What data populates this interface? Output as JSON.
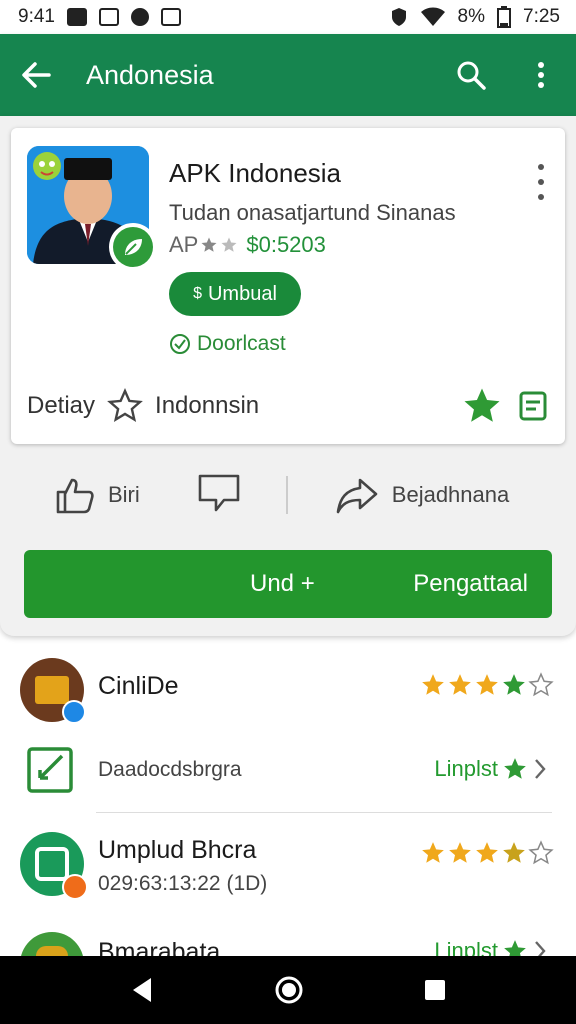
{
  "status_bar": {
    "time_left": "9:41",
    "battery_pct": "8%",
    "time_right": "7:25"
  },
  "app_bar": {
    "title": "Andonesia"
  },
  "app_card": {
    "title": "APK Indonesia",
    "subtitle": "Tudan onasatjartund Sinanas",
    "meta_prefix": "AP",
    "price": "$0:5203",
    "pill_label": "Umbual",
    "download_link": "Doorlcast",
    "bottom_label_1": "Detiay",
    "bottom_label_2": "Indonnsin"
  },
  "actions": {
    "like_label": "Biri",
    "share_label": "Bejadhnana"
  },
  "big_button": {
    "left_label": "Und +",
    "right_label": "Pengattaal"
  },
  "list": [
    {
      "title": "CinliDe",
      "rating": 3.5,
      "link": ""
    },
    {
      "title": "",
      "subtitle": "Daadocdsbrgra",
      "link": "Linplst"
    },
    {
      "title": "Umplud Bhcra",
      "subtitle": "029:63:13:22 (1D)",
      "rating": 4
    },
    {
      "title": "Bmarabata",
      "link": "Linplst"
    }
  ],
  "colors": {
    "primary": "#16854f",
    "accent": "#23962d",
    "star": "#f0a81c"
  }
}
